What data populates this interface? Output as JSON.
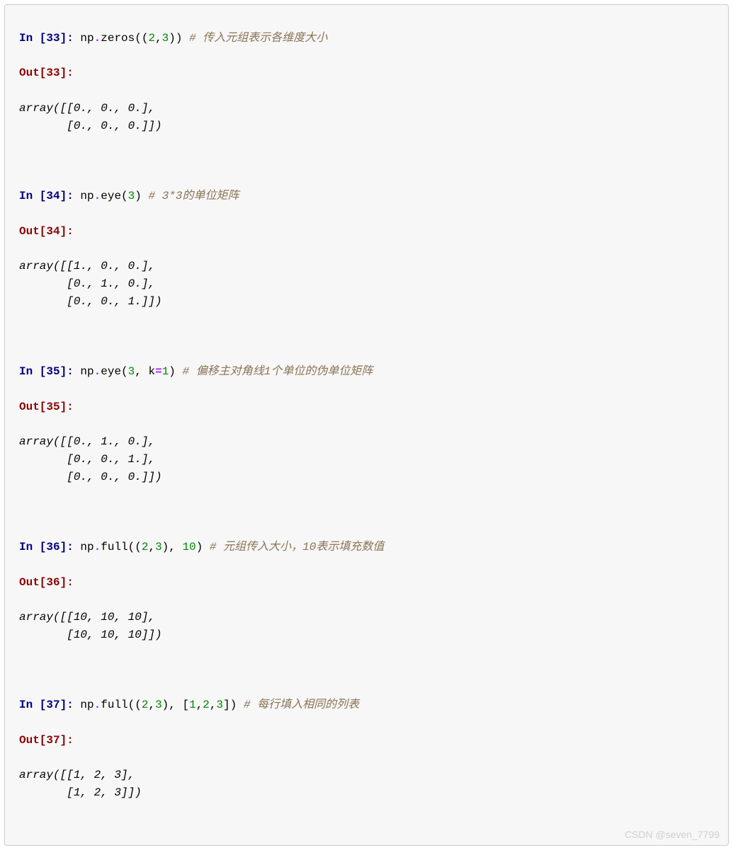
{
  "cells": [
    {
      "in_num": "33",
      "code_parts": {
        "obj": "np",
        "func": "zeros",
        "open": "((",
        "args": [
          "2",
          ",",
          "3"
        ],
        "close": "))",
        "comment": "# 传入元组表示各维度大小"
      },
      "output": "array([[0., 0., 0.],\n       [0., 0., 0.]])"
    },
    {
      "in_num": "34",
      "code_parts": {
        "obj": "np",
        "func": "eye",
        "open": "(",
        "args": [
          "3"
        ],
        "close": ")",
        "comment": "# 3*3的单位矩阵"
      },
      "output": "array([[1., 0., 0.],\n       [0., 1., 0.],\n       [0., 0., 1.]])"
    },
    {
      "in_num": "35",
      "code_parts": {
        "obj": "np",
        "func": "eye",
        "open": "(",
        "args_kw": {
          "pos": [
            "3"
          ],
          "kw_name": "k",
          "kw_val": "1"
        },
        "close": ")",
        "comment": "# 偏移主对角线1个单位的伪单位矩阵"
      },
      "output": "array([[0., 1., 0.],\n       [0., 0., 1.],\n       [0., 0., 0.]])"
    },
    {
      "in_num": "36",
      "code_parts": {
        "obj": "np",
        "func": "full",
        "open": "((",
        "args": [
          "2",
          ",",
          "3"
        ],
        "mid": "), ",
        "args2": [
          "10"
        ],
        "close": ")",
        "comment": "# 元组传入大小，10表示填充数值"
      },
      "output": "array([[10, 10, 10],\n       [10, 10, 10]])"
    },
    {
      "in_num": "37",
      "code_parts": {
        "obj": "np",
        "func": "full",
        "open": "((",
        "args": [
          "2",
          ",",
          "3"
        ],
        "mid": "), [",
        "args2": [
          "1",
          ",",
          "2",
          ",",
          "3"
        ],
        "close": "])",
        "comment": "# 每行填入相同的列表"
      },
      "output": "array([[1, 2, 3],\n       [1, 2, 3]])"
    }
  ],
  "watermark": "CSDN @seven_7799"
}
